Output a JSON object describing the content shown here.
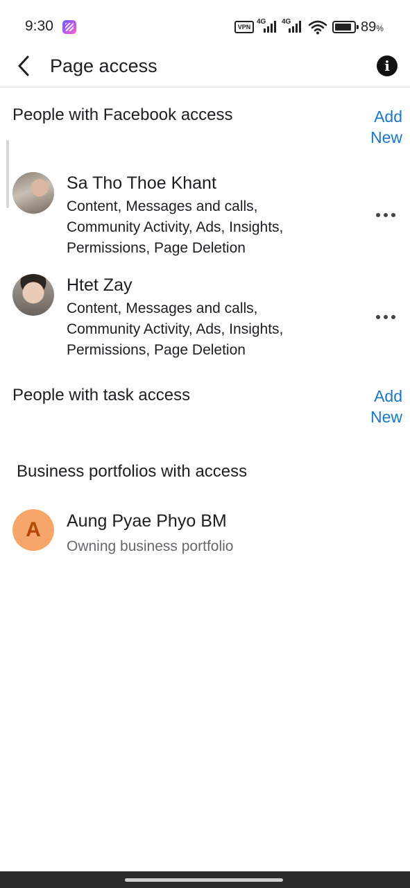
{
  "status_bar": {
    "time": "9:30",
    "vpn": "VPN",
    "network_1": "4G",
    "network_2": "4G",
    "battery_level": 0.89,
    "battery_percent": "89",
    "battery_percent_sign": "%"
  },
  "header": {
    "title": "Page access",
    "back_icon": "chevron-left-icon",
    "info_icon": "info-icon",
    "info_glyph": "i"
  },
  "facebook_access": {
    "title": "People with Facebook access",
    "add_new_label_1": "Add",
    "add_new_label_2": "New",
    "people": [
      {
        "name": "Sa Tho Thoe Khant",
        "perm_line_1": "Content, Messages and calls,",
        "perm_line_2": "Community Activity, Ads, Insights,",
        "perm_line_3": "Permissions, Page Deletion"
      },
      {
        "name": "Htet Zay",
        "perm_line_1": "Content, Messages and calls,",
        "perm_line_2": "Community Activity, Ads, Insights,",
        "perm_line_3": "Permissions, Page Deletion"
      }
    ]
  },
  "task_access": {
    "title": "People with task access",
    "add_new_label_1": "Add",
    "add_new_label_2": "New"
  },
  "business_portfolios": {
    "title": "Business portfolios with access",
    "items": [
      {
        "avatar_letter": "A",
        "name": "Aung Pyae Phyo BM",
        "subtitle": "Owning business portfolio"
      }
    ]
  },
  "colors": {
    "accent": "#1877c9",
    "portfolio_avatar": "#f7a66b",
    "portfolio_letter": "#b54708"
  }
}
